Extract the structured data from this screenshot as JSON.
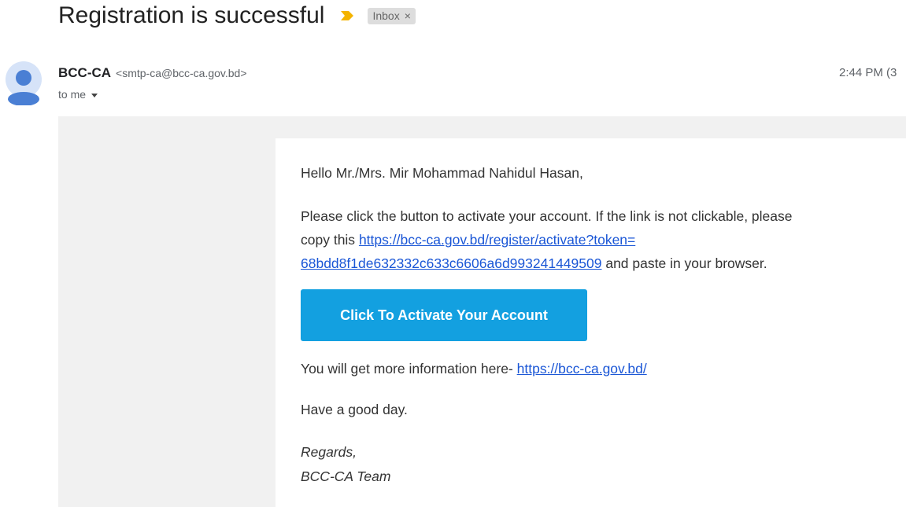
{
  "email": {
    "subject": "Registration is successful",
    "inbox_label": "Inbox",
    "inbox_remove": "×",
    "sender_name": "BCC-CA",
    "sender_email": "<smtp-ca@bcc-ca.gov.bd>",
    "recipient": "to me",
    "timestamp": "2:44 PM (3"
  },
  "message": {
    "greeting": "Hello Mr./Mrs. Mir Mohammad Nahidul Hasan,",
    "para1_line1": "Please click the button to activate your account. If the link is not clickable, please",
    "para1_line2_prefix": "copy this ",
    "activation_link_line1": "https://bcc-ca.gov.bd/register/activate?token=",
    "activation_link_line2": "68bdd8f1de632332c633c6606a6d993241449509",
    "para1_line3_suffix": " and paste in your browser.",
    "button_label": "Click To Activate Your Account",
    "info_prefix": "You will get more information here- ",
    "info_link": "https://bcc-ca.gov.bd/",
    "good_day": "Have a good day.",
    "regards": "Regards,",
    "signature": "BCC-CA Team"
  },
  "colors": {
    "button": "#13a0e0",
    "link": "#1a56d6",
    "importance_marker": "#f4b400",
    "avatar": "#4a7fd4"
  },
  "icons": {
    "importance": "importance-marker-icon",
    "avatar": "user-avatar-icon",
    "caret": "caret-down-icon"
  }
}
